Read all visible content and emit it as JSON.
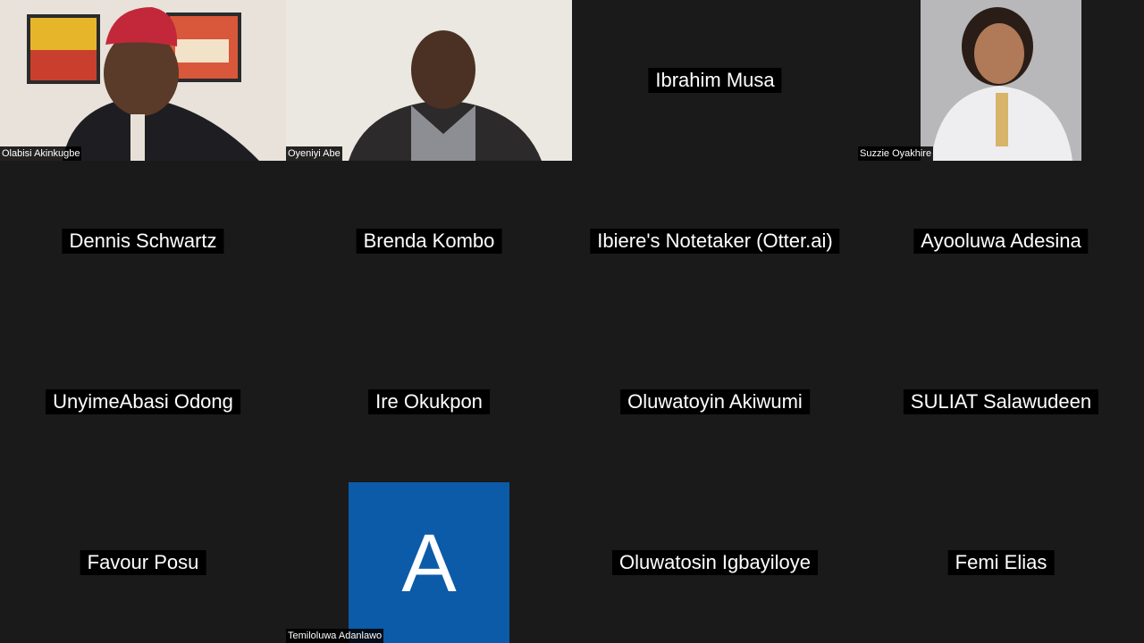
{
  "participants": [
    {
      "name": "Olabisi Akinkugbe",
      "video": true
    },
    {
      "name": "Oyeniyi Abe",
      "video": true
    },
    {
      "name": "Ibrahim Musa",
      "video": false
    },
    {
      "name": "Suzzie Oyakhire",
      "video": true
    },
    {
      "name": "Dennis Schwartz",
      "video": false
    },
    {
      "name": "Brenda Kombo",
      "video": false
    },
    {
      "name": "Ibiere's Notetaker (Otter.ai)",
      "video": false
    },
    {
      "name": "Ayooluwa Adesina",
      "video": false
    },
    {
      "name": "UnyimeAbasi Odong",
      "video": false
    },
    {
      "name": "Ire Okukpon",
      "video": false
    },
    {
      "name": "Oluwatoyin Akiwumi",
      "video": false
    },
    {
      "name": "SULIAT Salawudeen",
      "video": false
    },
    {
      "name": "Favour Posu",
      "video": false
    },
    {
      "name": "Temiloluwa Adanlawo",
      "video": false,
      "avatar_letter": "A",
      "avatar_color": "#0b5ba8"
    },
    {
      "name": "Oluwatosin Igbayiloye",
      "video": false
    },
    {
      "name": "Femi Elias",
      "video": false
    }
  ],
  "theme": {
    "background": "#1a1a1a",
    "label_background": "#000000",
    "label_text": "#ffffff"
  }
}
